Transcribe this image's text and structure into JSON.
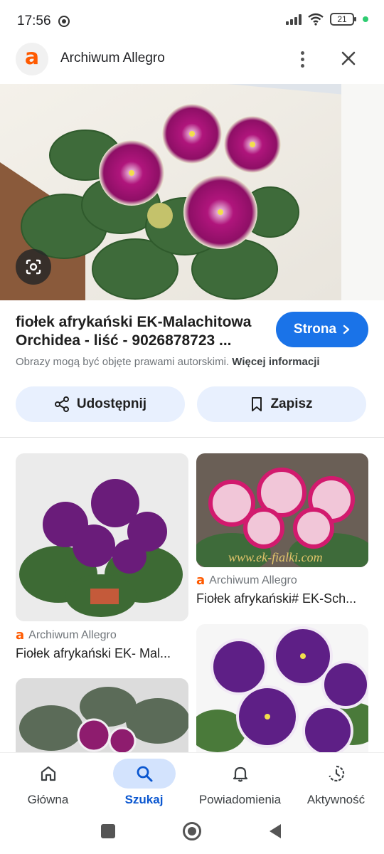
{
  "status_bar": {
    "time": "17:56",
    "battery": "21"
  },
  "header": {
    "site_logo": "a",
    "title": "Archiwum Allegro"
  },
  "result": {
    "title": "fiołek afrykański EK-Malachitowa Orchidea - liść - 9026878723 ...",
    "visit_label": "Strona",
    "copyright_text": "Obrazy mogą być objęte prawami autorskimi.",
    "copyright_link": "Więcej informacji"
  },
  "actions": {
    "share_label": "Udostępnij",
    "save_label": "Zapisz"
  },
  "related": [
    {
      "source": "Archiwum Allegro",
      "title": "Fiołek afrykański EK- Mal..."
    },
    {
      "source": "Archiwum Allegro",
      "title": "Fiołek afrykański# EK-Sch...",
      "watermark": "www.ek-fialki.com"
    }
  ],
  "bottom_nav": [
    {
      "label": "Główna",
      "icon": "home-icon"
    },
    {
      "label": "Szukaj",
      "icon": "search-icon",
      "active": true
    },
    {
      "label": "Powiadomienia",
      "icon": "bell-icon"
    },
    {
      "label": "Aktywność",
      "icon": "activity-icon"
    }
  ],
  "colors": {
    "accent": "#1a73e8",
    "brand": "#ff5a00",
    "tonal": "#e8f0fe",
    "active_nav": "#d3e3fd"
  }
}
